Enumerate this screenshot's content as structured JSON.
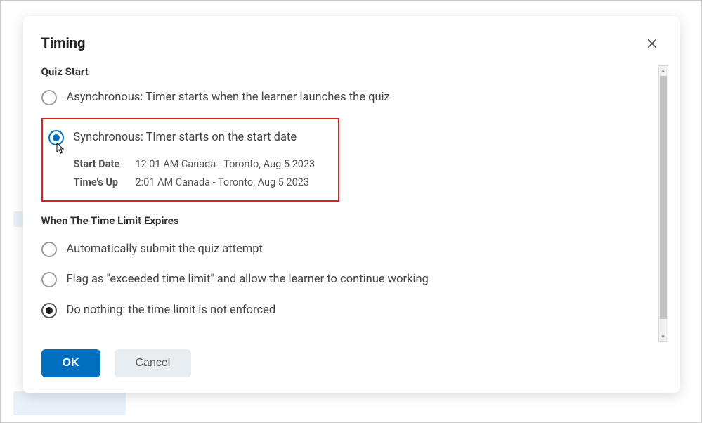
{
  "modal": {
    "title": "Timing",
    "quiz_start": {
      "heading": "Quiz Start",
      "async_label": "Asynchronous: Timer starts when the learner launches the quiz",
      "sync_label": "Synchronous: Timer starts on the start date",
      "start_date_label": "Start Date",
      "start_date_value": "12:01 AM Canada - Toronto, Aug 5 2023",
      "times_up_label": "Time's Up",
      "times_up_value": "2:01 AM Canada - Toronto, Aug 5 2023"
    },
    "when_expires": {
      "heading": "When The Time Limit Expires",
      "auto_submit_label": "Automatically submit the quiz attempt",
      "flag_exceeded_label": "Flag as \"exceeded time limit\" and allow the learner to continue working",
      "do_nothing_label": "Do nothing: the time limit is not enforced"
    },
    "footer": {
      "ok_label": "OK",
      "cancel_label": "Cancel"
    }
  }
}
